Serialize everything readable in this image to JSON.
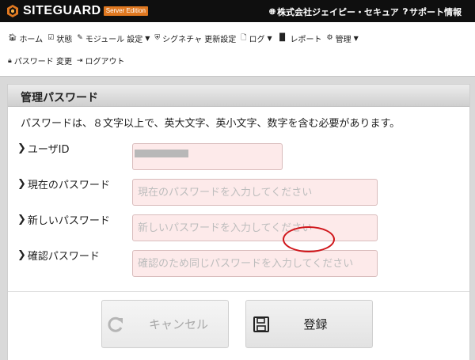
{
  "header": {
    "logo_text": "SITEGUARD",
    "logo_badge": "Server Edition",
    "company_link": "株式会社ジェイピー・セキュア",
    "support_link": "サポート情報"
  },
  "nav": {
    "row1": [
      {
        "label": "ホーム",
        "icon": "home-icon",
        "caret": false
      },
      {
        "label": "状態",
        "icon": "check-icon",
        "caret": false
      },
      {
        "label": "モジュール 設定",
        "icon": "edit-icon",
        "caret": true
      },
      {
        "label": "シグネチャ 更新設定",
        "icon": "shield-icon",
        "caret": false
      },
      {
        "label": "ログ",
        "icon": "file-icon",
        "caret": true
      },
      {
        "label": "レポート",
        "icon": "chart-icon",
        "caret": false
      },
      {
        "label": "管理",
        "icon": "gear-icon",
        "caret": true
      }
    ],
    "row2": [
      {
        "label": "パスワード 変更",
        "icon": "lock-icon",
        "caret": false
      },
      {
        "label": "ログアウト",
        "icon": "logout-icon",
        "caret": false
      }
    ]
  },
  "panel": {
    "title": "管理パスワード",
    "notice": "パスワードは、８文字以上で、英大文字、英小文字、数字を含む必要があります。"
  },
  "form": {
    "userid_label": "ユーザID",
    "userid_value": "'",
    "current_label": "現在のパスワード",
    "current_placeholder": "現在のパスワードを入力してください",
    "new_label": "新しいパスワード",
    "new_placeholder": "新しいパスワードを入力してください",
    "confirm_label": "確認パスワード",
    "confirm_placeholder": "確認のため同じパスワードを入力してください"
  },
  "buttons": {
    "cancel": "キャンセル",
    "save": "登録"
  },
  "colors": {
    "header_bg": "#0f0f0f",
    "badge": "#e07820",
    "input_bg": "#fdeaea",
    "highlight": "#d0161b"
  }
}
